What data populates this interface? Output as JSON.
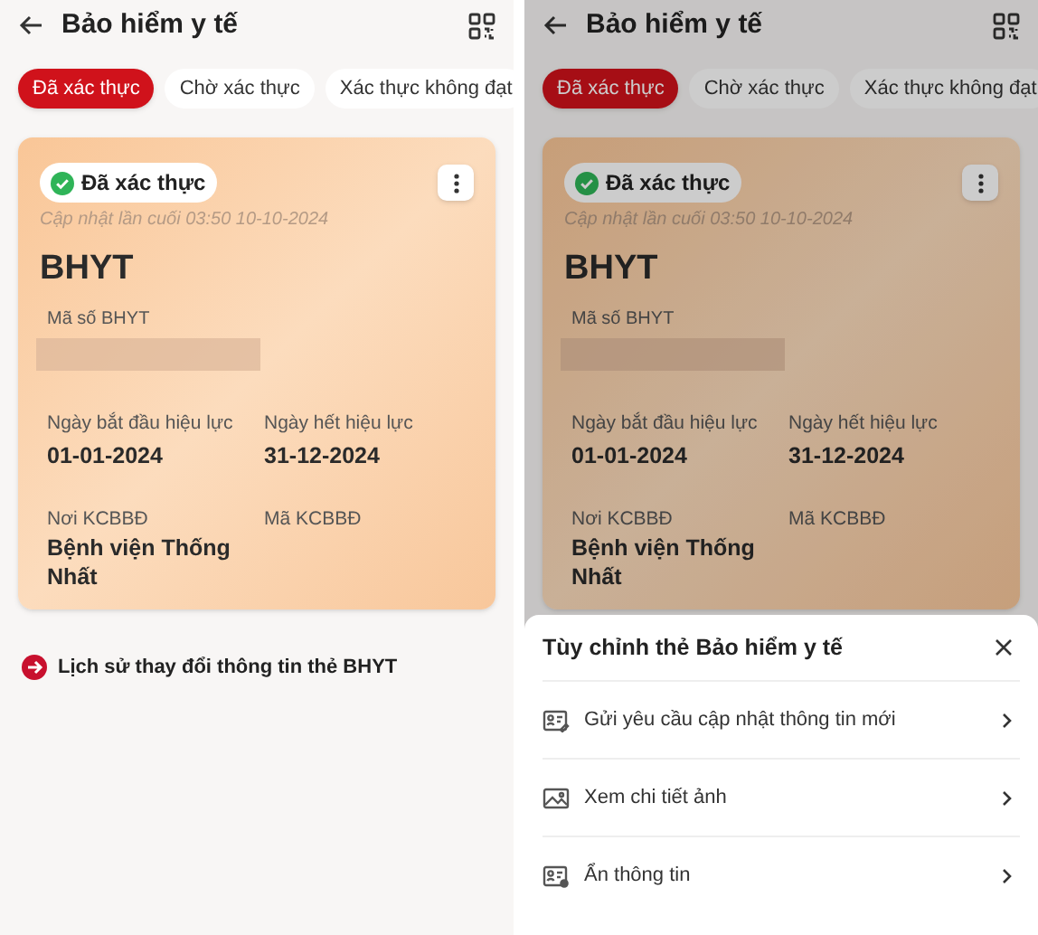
{
  "screens": [
    {
      "title": "Bảo hiểm y tế",
      "tabs": [
        {
          "label": "Đã xác thực",
          "selected": true
        },
        {
          "label": "Chờ xác thực",
          "selected": false
        },
        {
          "label": "Xác thực không đạt",
          "selected": false
        }
      ],
      "card": {
        "status": "Đã xác thực",
        "updated": "Cập nhật lần cuối 03:50 10-10-2024",
        "type": "BHYT",
        "number_label": "Mã số BHYT",
        "number_hidden": true,
        "start_label": "Ngày bắt đầu hiệu lực",
        "start": "01-01-2024",
        "end_label": "Ngày hết hiệu lực",
        "end": "31-12-2024",
        "place_label": "Nơi KCBBĐ",
        "place": "Bệnh viện Thống Nhất",
        "place_code_label": "Mã KCBBĐ"
      },
      "history_link": "Lịch sử thay đổi thông tin thẻ BHYT",
      "dimmed": false
    },
    {
      "title": "Bảo hiểm y tế",
      "tabs": [
        {
          "label": "Đã xác thực",
          "selected": true
        },
        {
          "label": "Chờ xác thực",
          "selected": false
        },
        {
          "label": "Xác thực không đạt",
          "selected": false
        }
      ],
      "card": {
        "status": "Đã xác thực",
        "updated": "Cập nhật lần cuối 03:50 10-10-2024",
        "type": "BHYT",
        "number_label": "Mã số BHYT",
        "number_hidden": true,
        "start_label": "Ngày bắt đầu hiệu lực",
        "start": "01-01-2024",
        "end_label": "Ngày hết hiệu lực",
        "end": "31-12-2024",
        "place_label": "Nơi KCBBĐ",
        "place": "Bệnh viện Thống Nhất",
        "place_code_label": "Mã KCBBĐ"
      },
      "dimmed": true,
      "sheet": {
        "title": "Tùy chỉnh thẻ Bảo hiểm y tế",
        "items": [
          {
            "label": "Gửi yêu cầu cập nhật thông tin mới",
            "kind": "card-edit"
          },
          {
            "label": "Xem chi tiết ảnh",
            "kind": "image"
          },
          {
            "label": "Ẩn thông tin",
            "kind": "card-hide"
          }
        ]
      }
    }
  ]
}
